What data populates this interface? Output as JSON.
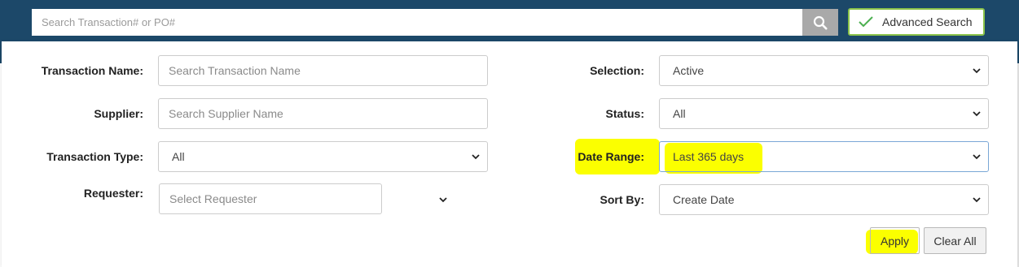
{
  "search": {
    "placeholder": "Search Transaction# or PO#",
    "search_icon": "search-icon",
    "advanced_label": "Advanced Search",
    "advanced_icon": "check-icon"
  },
  "form": {
    "transaction_name": {
      "label": "Transaction Name:",
      "placeholder": "Search Transaction Name"
    },
    "supplier": {
      "label": "Supplier:",
      "placeholder": "Search Supplier Name"
    },
    "transaction_type": {
      "label": "Transaction Type:",
      "value": "All"
    },
    "requester": {
      "label": "Requester:",
      "placeholder": "Select Requester"
    },
    "selection": {
      "label": "Selection:",
      "value": "Active"
    },
    "status": {
      "label": "Status:",
      "value": "All"
    },
    "date_range": {
      "label": "Date Range:",
      "value": "Last 365 days"
    },
    "sort_by": {
      "label": "Sort By:",
      "value": "Create Date"
    }
  },
  "actions": {
    "apply_label": "Apply",
    "clear_label": "Clear All"
  },
  "colors": {
    "header": "#1c4869",
    "highlight": "#fbff00",
    "advanced_border": "#8bc34a",
    "search_button": "#a9a9a9"
  }
}
